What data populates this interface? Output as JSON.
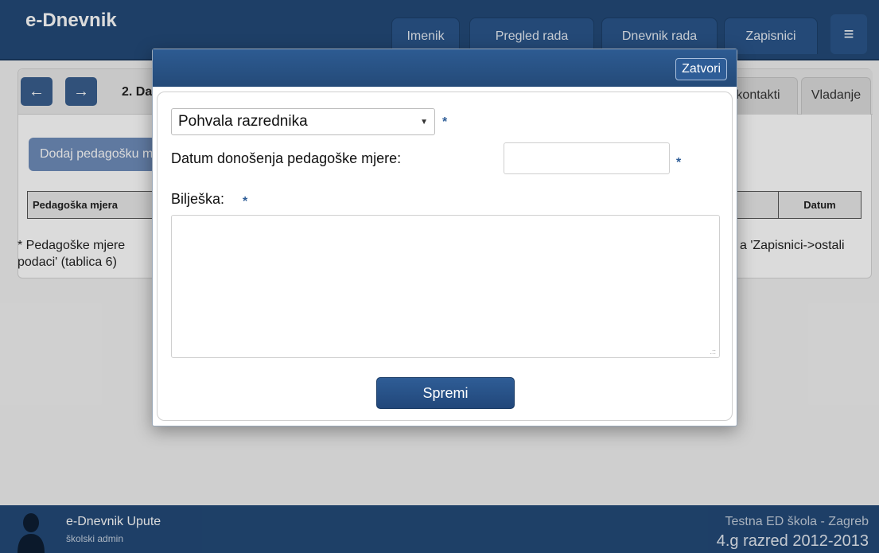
{
  "header": {
    "brand": "e-Dnevnik",
    "nav": [
      "Imenik",
      "Pregled rada",
      "Dnevnik rada",
      "Zapisnici"
    ],
    "menu_icon": "hamburger-icon"
  },
  "page": {
    "back_icon": "arrow-left-icon",
    "forward_icon": "arrow-right-icon",
    "breadcrumb": "2. Da",
    "tabs": [
      "kontakti",
      "Vladanje"
    ],
    "add_button": "Dodaj pedagošku m",
    "table": {
      "col1": "Pedagoška mjera",
      "col2": "Datum"
    },
    "note_line1_left": "* Pedagoške mjere",
    "note_line1_right": "a 'Zapisnici->ostali",
    "note_line2": "podaci' (tablica 6)"
  },
  "modal": {
    "close_label": "Zatvori",
    "select_value": "Pohvala razrednika",
    "date_label": "Datum donošenja pedagoške mjere:",
    "date_value": "",
    "note_label": "Bilješka:",
    "note_value": "",
    "required_mark": "*",
    "save_label": "Spremi"
  },
  "footer": {
    "link": "e-Dnevnik Upute",
    "role": "školski admin",
    "school": "Testna ED škola - Zagreb",
    "class_year": "4.g razred 2012-2013"
  },
  "colors": {
    "primary": "#234a78",
    "accent": "#2e5d97"
  }
}
